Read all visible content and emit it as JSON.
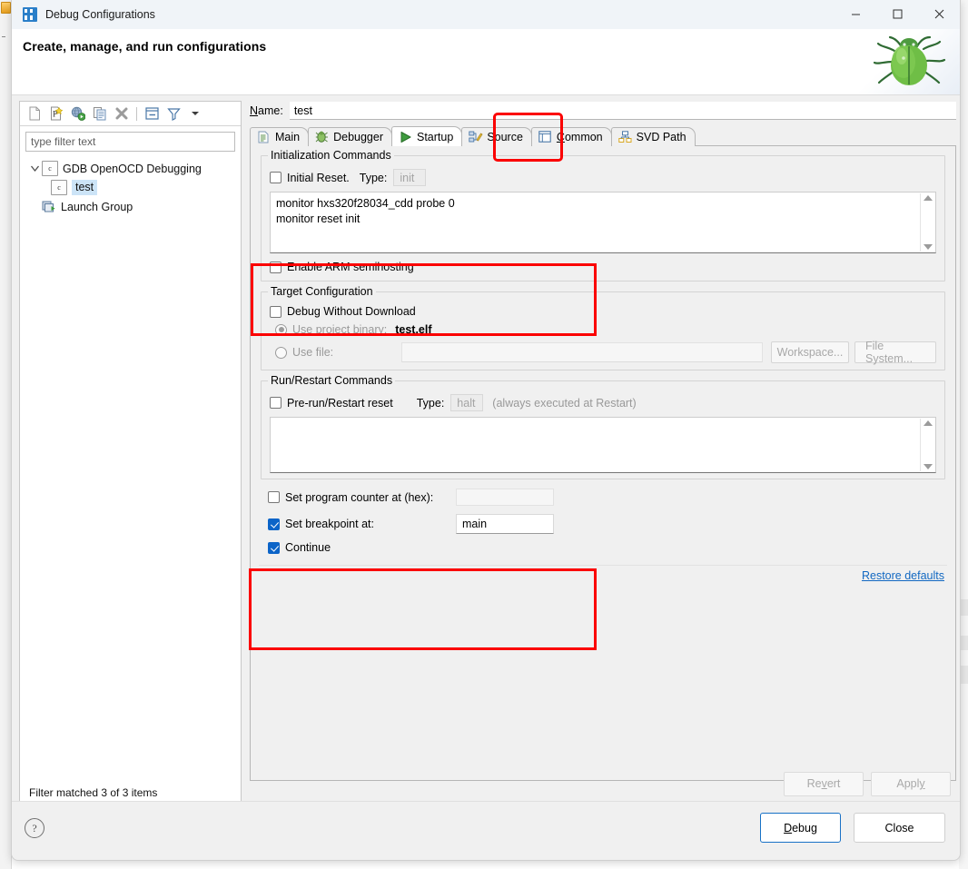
{
  "window": {
    "title": "Debug Configurations",
    "icon": "eclipse-debug-icon",
    "minimize": "–",
    "maximize": "□",
    "close": "✕"
  },
  "header": {
    "title": "Create, manage, and run configurations",
    "decoration_icon": "green-bug-icon"
  },
  "tree_toolbar": {
    "icons": [
      "new-configuration-icon",
      "new-prototype-icon",
      "export-icon",
      "duplicate-icon",
      "delete-icon",
      "collapse-all-icon",
      "filter-icon",
      "view-menu-chevron-icon"
    ]
  },
  "filter": {
    "placeholder": "type filter text",
    "status": "Filter matched 3 of 3 items"
  },
  "tree": {
    "items": [
      {
        "label": "GDB OpenOCD Debugging",
        "icon": "c-launch-icon",
        "expanded": true,
        "selected": false,
        "indent": 0
      },
      {
        "label": "test",
        "icon": "c-launch-icon",
        "expanded": false,
        "selected": true,
        "indent": 1
      },
      {
        "label": "Launch Group",
        "icon": "launch-group-icon",
        "expanded": false,
        "selected": false,
        "indent": 0
      }
    ]
  },
  "name_field": {
    "label": "Name:",
    "label_mnemonic": "N",
    "value": "test"
  },
  "tabs": [
    {
      "label": "Main",
      "icon": "document-icon",
      "active": false,
      "mnemonic": ""
    },
    {
      "label": "Debugger",
      "icon": "debugger-bug-icon",
      "active": false,
      "mnemonic": ""
    },
    {
      "label": "Startup",
      "icon": "green-play-icon",
      "active": true,
      "mnemonic": ""
    },
    {
      "label": "Source",
      "icon": "source-lookup-icon",
      "active": false,
      "mnemonic": ""
    },
    {
      "label": "Common",
      "icon": "common-icon",
      "active": false,
      "mnemonic": "C"
    },
    {
      "label": "SVD Path",
      "icon": "svd-tree-icon",
      "active": false,
      "mnemonic": ""
    }
  ],
  "startup": {
    "initialization_group": {
      "legend": "Initialization Commands",
      "initial_reset": {
        "label": "Initial Reset.",
        "checked": false
      },
      "type_label": "Type:",
      "type_value": "init",
      "commands_text": "monitor hxs320f28034_cdd probe 0\nmonitor reset init",
      "commands_line1": "monitor hxs320f28034_cdd probe 0",
      "commands_line2": "monitor reset init",
      "enable_semihosting": {
        "label": "Enable ARM semihosting",
        "checked": false
      }
    },
    "target_group": {
      "legend": "Target Configuration",
      "debug_without_download": {
        "label": "Debug Without Download",
        "checked": false
      },
      "use_project_binary": {
        "label": "Use project binary:",
        "value": "test.elf",
        "selected": true
      },
      "use_file": {
        "label": "Use file:",
        "value": "",
        "selected": false
      },
      "workspace_button": "Workspace...",
      "file_system_button": "File System..."
    },
    "run_restart_group": {
      "legend": "Run/Restart Commands",
      "pre_run_reset": {
        "label": "Pre-run/Restart reset",
        "checked": false
      },
      "type_label": "Type:",
      "type_value": "halt",
      "note": "(always executed at Restart)",
      "commands_text": ""
    },
    "final_group": {
      "set_program_counter": {
        "label": "Set program counter at (hex):",
        "checked": false,
        "value": ""
      },
      "set_breakpoint": {
        "label": "Set breakpoint at:",
        "checked": true,
        "value": "main"
      },
      "continue": {
        "label": "Continue",
        "checked": true
      }
    },
    "restore_defaults": "Restore defaults"
  },
  "buttons": {
    "revert": "Revert",
    "apply": "Apply",
    "debug": "Debug",
    "debug_mnemonic": "D",
    "close": "Close",
    "help": "?"
  },
  "annotations": {
    "highlight_color": "#fb0000",
    "boxes": [
      {
        "name": "startup-tab-highlight"
      },
      {
        "name": "init-commands-highlight"
      },
      {
        "name": "startup-options-highlight"
      }
    ]
  }
}
